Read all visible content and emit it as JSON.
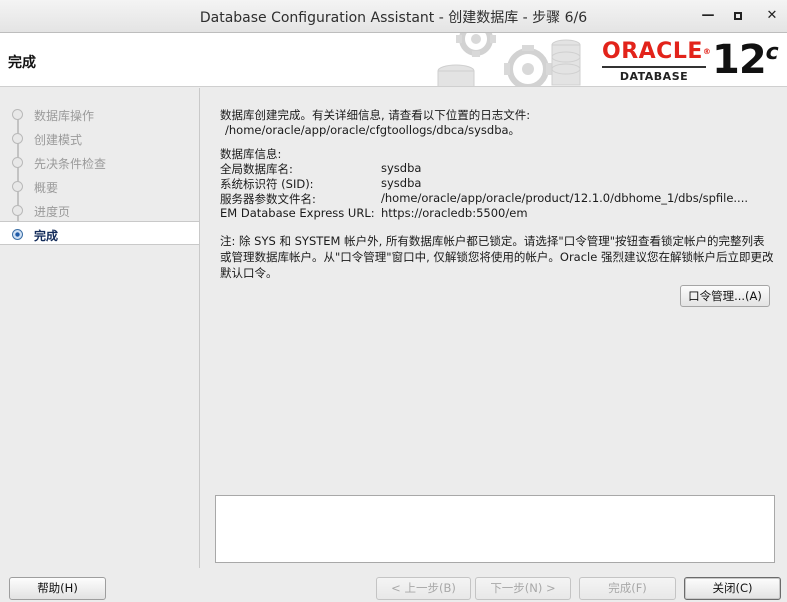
{
  "window": {
    "title": "Database Configuration Assistant - 创建数据库 - 步骤 6/6",
    "minimize": "—",
    "close": "✕"
  },
  "header": {
    "step_title": "完成",
    "logo": {
      "brand": "ORACLE",
      "reg": "®",
      "product": "DATABASE",
      "version": "12",
      "version_suffix": "c"
    }
  },
  "sidebar": {
    "steps": [
      {
        "label": "数据库操作",
        "state": "done"
      },
      {
        "label": "创建模式",
        "state": "done"
      },
      {
        "label": "先决条件检查",
        "state": "done"
      },
      {
        "label": "概要",
        "state": "done"
      },
      {
        "label": "进度页",
        "state": "done"
      },
      {
        "label": "完成",
        "state": "active"
      }
    ]
  },
  "main": {
    "intro_line1": "数据库创建完成。有关详细信息, 请查看以下位置的日志文件:",
    "intro_line2": "/home/oracle/app/oracle/cfgtoollogs/dbca/sysdba。",
    "info_heading": "数据库信息:",
    "info": [
      {
        "label": "全局数据库名:",
        "value": "sysdba"
      },
      {
        "label": "系统标识符 (SID):",
        "value": "sysdba"
      },
      {
        "label": "服务器参数文件名:",
        "value": "/home/oracle/app/oracle/product/12.1.0/dbhome_1/dbs/spfile...."
      },
      {
        "label": "EM Database Express URL:",
        "value": "https://oracledb:5500/em"
      }
    ],
    "note": "注: 除 SYS 和 SYSTEM 帐户外, 所有数据库帐户都已锁定。请选择\"口令管理\"按钮查看锁定帐户的完整列表或管理数据库帐户。从\"口令管理\"窗口中, 仅解锁您将使用的帐户。Oracle 强烈建议您在解锁帐户后立即更改默认口令。",
    "password_button": "口令管理...(A)"
  },
  "buttons": {
    "help": "帮助(H)",
    "back": "< 上一步(B)",
    "next": "下一步(N) >",
    "finish": "完成(F)",
    "close": "关闭(C)"
  },
  "colors": {
    "oracle_red": "#e2231a",
    "active_step_text": "#142c5a",
    "active_step_dot": "#1e5aa8"
  }
}
